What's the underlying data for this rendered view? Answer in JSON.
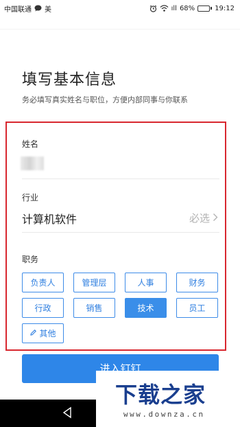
{
  "status_bar": {
    "carrier": "中国联通",
    "extra": "美",
    "signal_label": "ıll",
    "battery_percent": "68%",
    "battery_level": 0.68,
    "time": "19:12"
  },
  "header": {
    "title": "填写基本信息",
    "subtitle": "务必填写真实姓名与职位，方便内部同事与你联系"
  },
  "form": {
    "name_label": "姓名",
    "industry_label": "行业",
    "industry_value": "计算机软件",
    "industry_required": "必选",
    "role_label": "职务",
    "roles": [
      "负责人",
      "管理层",
      "人事",
      "财务",
      "行政",
      "销售",
      "技术",
      "员工",
      "其他"
    ],
    "selected_role": "技术"
  },
  "actions": {
    "enter_label": "进入钉钉"
  },
  "watermark": {
    "title": "下载之家",
    "url": "www.downza.cn"
  },
  "colors": {
    "accent": "#2e86e8",
    "highlight_frame": "#d8262e",
    "watermark_text": "#1a3f8f"
  },
  "icons": {
    "wechat": "chat-bubble-icon",
    "alarm": "alarm-clock-icon",
    "wifi": "wifi-icon",
    "battery": "battery-icon",
    "chevron": "chevron-right-icon",
    "edit": "pencil-icon",
    "back": "back-triangle-icon"
  }
}
